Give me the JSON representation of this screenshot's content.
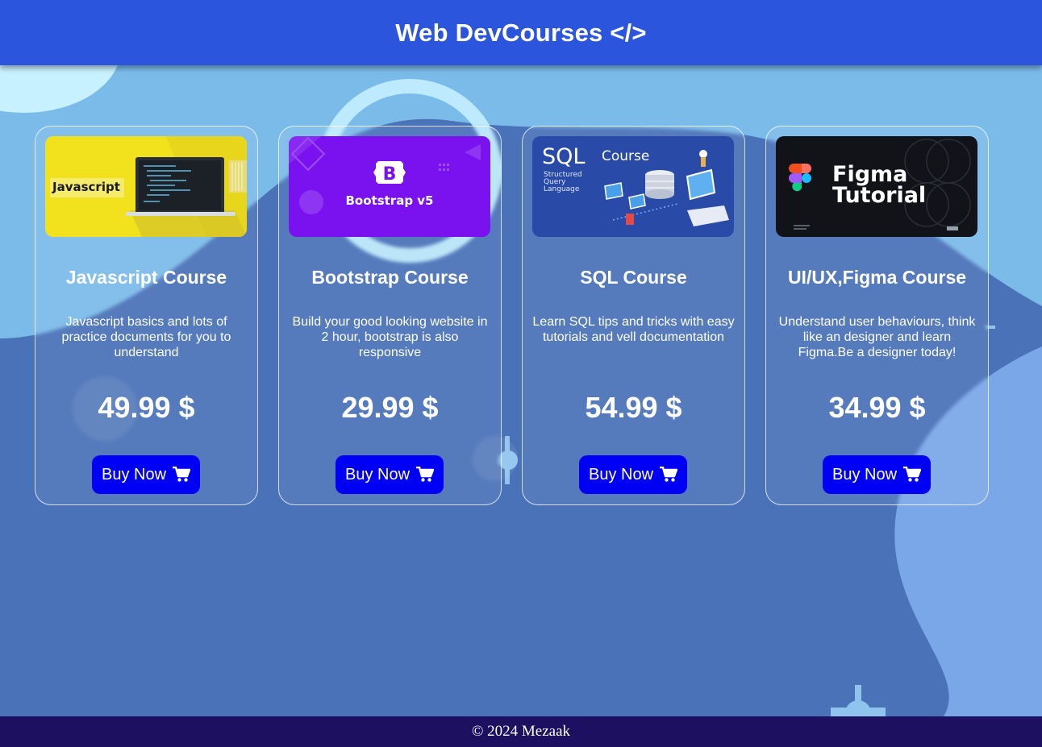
{
  "header": {
    "title": "Web DevCourses </>"
  },
  "courses": [
    {
      "title": "Javascript Course",
      "description": "Javascript basics and lots of practice documents for you to understand",
      "price": "49.99 $",
      "button_label": "Buy Now",
      "thumbnail": {
        "label": "Javascript",
        "colors": {
          "bg": "#f2e21e",
          "accent": "#d9c92a",
          "laptop": "#2a2f36"
        }
      }
    },
    {
      "title": "Bootstrap Course",
      "description": "Build your good looking website in 2 hour, bootstrap is also responsive",
      "price": "29.99 $",
      "button_label": "Buy Now",
      "thumbnail": {
        "logo_letter": "B",
        "label": "Bootstrap v5",
        "colors": {
          "bg": "#7a12f0",
          "logo": "#ffffff"
        }
      }
    },
    {
      "title": "SQL Course",
      "description": "Learn SQL tips and tricks with easy tutorials and vell documentation",
      "price": "54.99 $",
      "button_label": "Buy Now",
      "thumbnail": {
        "label_main": "SQL",
        "label_sub": "Course",
        "subtitle_lines": [
          "Structured",
          "Query",
          "Language"
        ],
        "colors": {
          "bg": "#2a4aa8"
        }
      }
    },
    {
      "title": "UI/UX,Figma Course",
      "description": "Understand user behaviours, think like an designer and learn Figma.Be a designer today!",
      "price": "34.99 $",
      "button_label": "Buy Now",
      "thumbnail": {
        "line1": "Figma",
        "line2": "Tutorial",
        "colors": {
          "bg": "#111318"
        }
      }
    }
  ],
  "footer": {
    "text": "© 2024 Mezaak"
  },
  "icons": {
    "cart": "shopping-cart-icon"
  },
  "colors": {
    "header_bg": "#2b55dc",
    "button_bg": "#0000f5",
    "footer_bg": "#1e1060",
    "page_bg": "#4a72b8"
  }
}
